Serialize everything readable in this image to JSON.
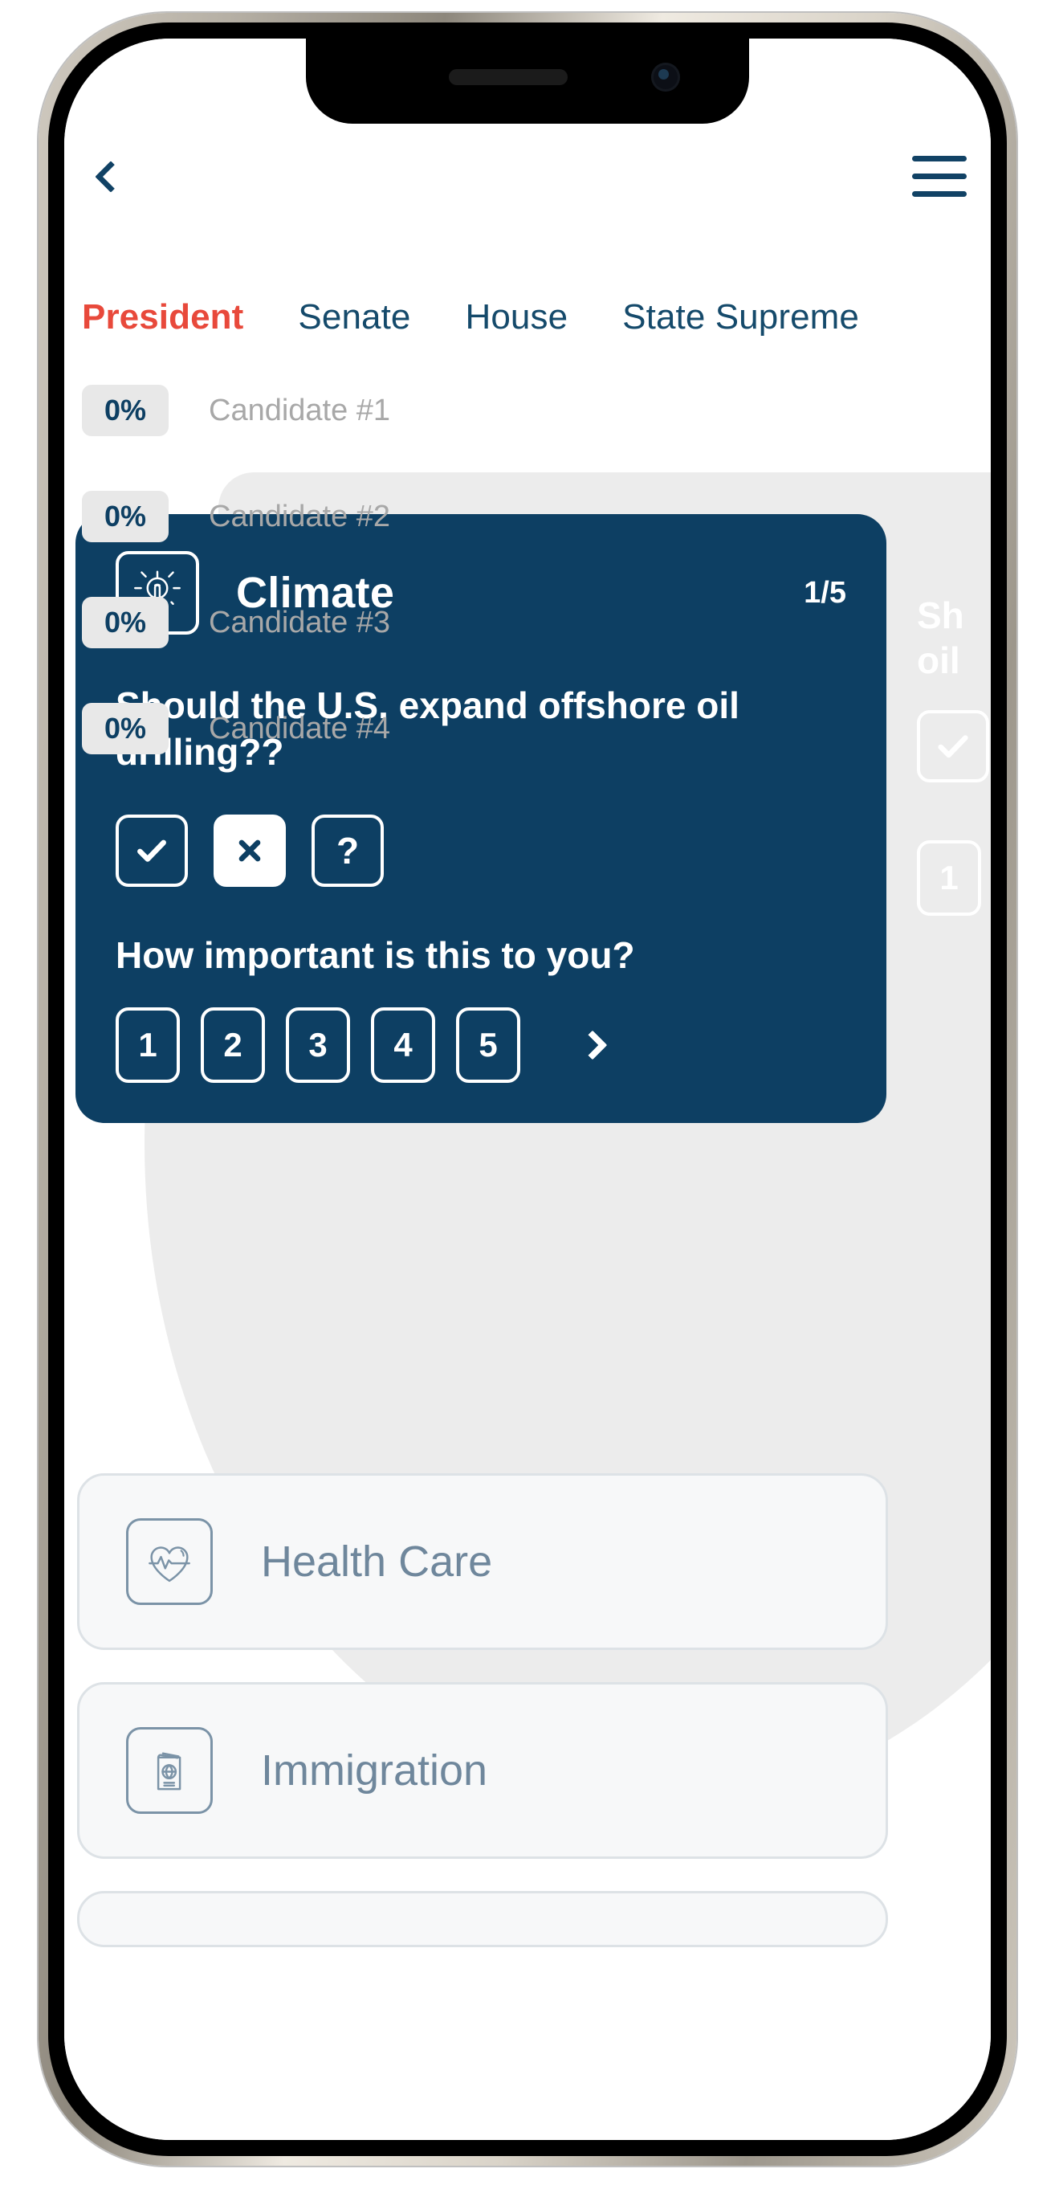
{
  "app": {
    "accent_red": "#e8493b",
    "navy": "#0d3f63",
    "slate": "#6f879c",
    "badge_bg": "#e8e8e8"
  },
  "topbar": {
    "back_label": "Back",
    "back_icon": "chevron-left-icon",
    "menu_label": "Menu",
    "menu_icon": "hamburger-menu-icon"
  },
  "tabs": [
    {
      "label": "President",
      "active": true
    },
    {
      "label": "Senate",
      "active": false
    },
    {
      "label": "House",
      "active": false
    },
    {
      "label": "State Supreme",
      "active": false
    }
  ],
  "candidates": [
    {
      "percent": "0%",
      "name": "Candidate #1"
    },
    {
      "percent": "0%",
      "name": "Candidate #2"
    },
    {
      "percent": "0%",
      "name": "Candidate #3"
    },
    {
      "percent": "0%",
      "name": "Candidate #4"
    }
  ],
  "issue_card": {
    "icon": "sun-thermometer-icon",
    "title": "Climate",
    "counter": "1/5",
    "question": "Should the U.S. expand offshore oil drilling??",
    "answers": [
      {
        "id": "yes",
        "glyph": "✔",
        "icon": "check-icon",
        "selected": false
      },
      {
        "id": "no",
        "glyph": "✖",
        "icon": "close-x-icon",
        "selected": true
      },
      {
        "id": "unsure",
        "glyph": "?",
        "icon": "question-mark-icon",
        "selected": false
      }
    ],
    "importance_label": "How important is this to you?",
    "ratings": [
      {
        "value": "1",
        "selected": false
      },
      {
        "value": "2",
        "selected": false
      },
      {
        "value": "3",
        "selected": false
      },
      {
        "value": "4",
        "selected": false
      },
      {
        "value": "5",
        "selected": false
      }
    ],
    "next_icon": "chevron-right-icon"
  },
  "ghost_card": {
    "question_line1": "Sh",
    "question_line2": "oil",
    "rating_value": "1"
  },
  "topics": [
    {
      "label": "Health Care",
      "icon": "heart-pulse-icon"
    },
    {
      "label": "Immigration",
      "icon": "passport-globe-icon"
    }
  ]
}
